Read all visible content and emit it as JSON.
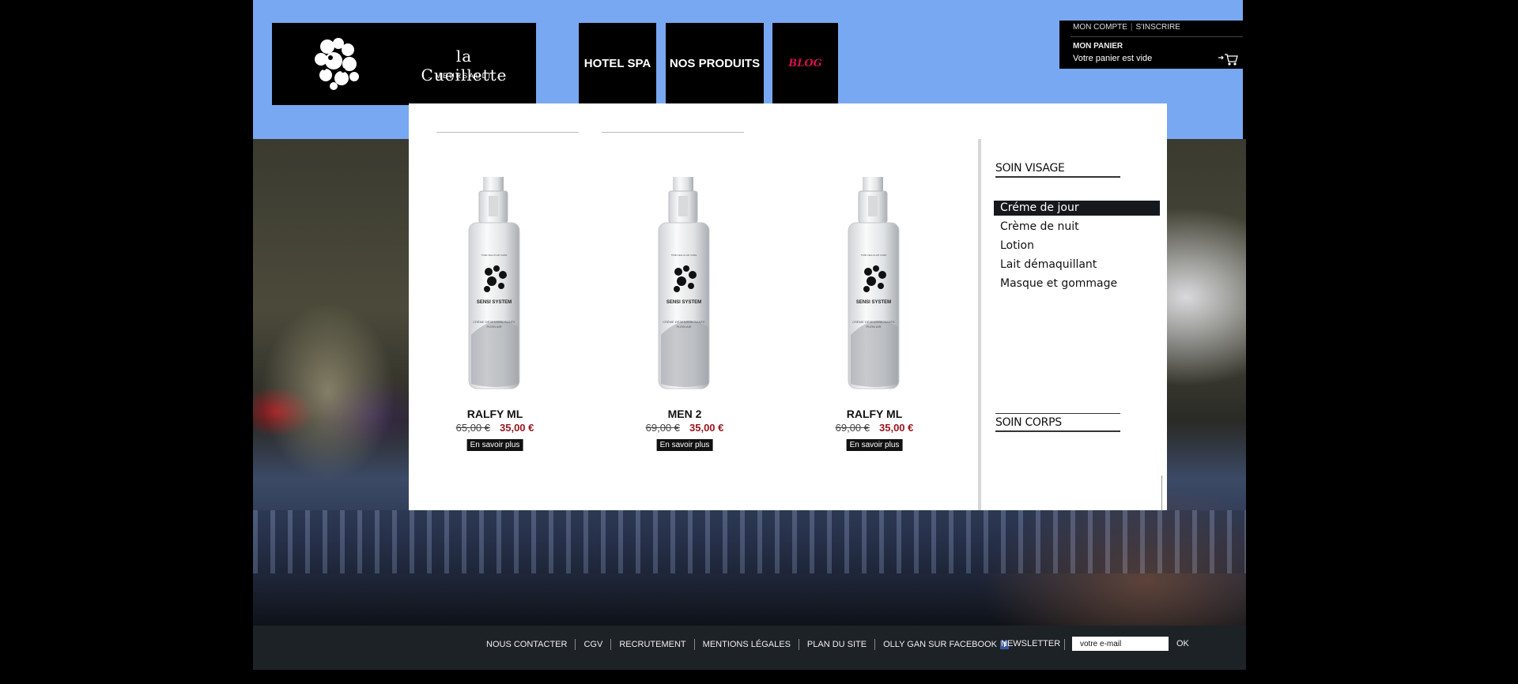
{
  "brand": {
    "name": "la Cueillette",
    "place": ". MEURSAULT ."
  },
  "nav": {
    "spa": "HOTEL SPA",
    "products": "NOS PRODUITS",
    "blog": "BLOG"
  },
  "account": {
    "my_account": "MON COMPTE",
    "signup": "S'INSCRIRE",
    "cart_title": "MON PANIER",
    "cart_status": "Votre panier est vide"
  },
  "products": [
    {
      "name": "RALFY ML",
      "old_price": "65,00 €",
      "price": "35,00 €",
      "cta": "En savoir plus"
    },
    {
      "name": "MEN 2",
      "old_price": "69,00 €",
      "price": "35,00 €",
      "cta": "En savoir plus"
    },
    {
      "name": "RALFY ML",
      "old_price": "69,00 €",
      "price": "35,00 €",
      "cta": "En savoir plus"
    }
  ],
  "sidebar": {
    "visage_title": "SOIN VISAGE",
    "items": [
      {
        "label": "Créme de jour",
        "active": true
      },
      {
        "label": "Crème de nuit",
        "active": false
      },
      {
        "label": "Lotion",
        "active": false
      },
      {
        "label": "Lait démaquillant",
        "active": false
      },
      {
        "label": "Masque et gommage",
        "active": false
      }
    ],
    "corps_title": "SOIN CORPS"
  },
  "footer": {
    "links": [
      "NOUS CONTACTER",
      "CGV",
      "RECRUTEMENT",
      "MENTIONS LÉGALES",
      "PLAN DU SITE",
      "OLLY GAN SUR FACEBOOK"
    ],
    "newsletter": "NEWSLETTER",
    "email_value": "votre e-mail",
    "ok": "OK"
  },
  "colors": {
    "sky": "#78a8f2",
    "price": "#9a1620",
    "blog": "#d31247"
  },
  "icons": {
    "cart": "cart-icon",
    "facebook": "facebook-icon",
    "logo": "leaf-cluster-logo-icon"
  }
}
